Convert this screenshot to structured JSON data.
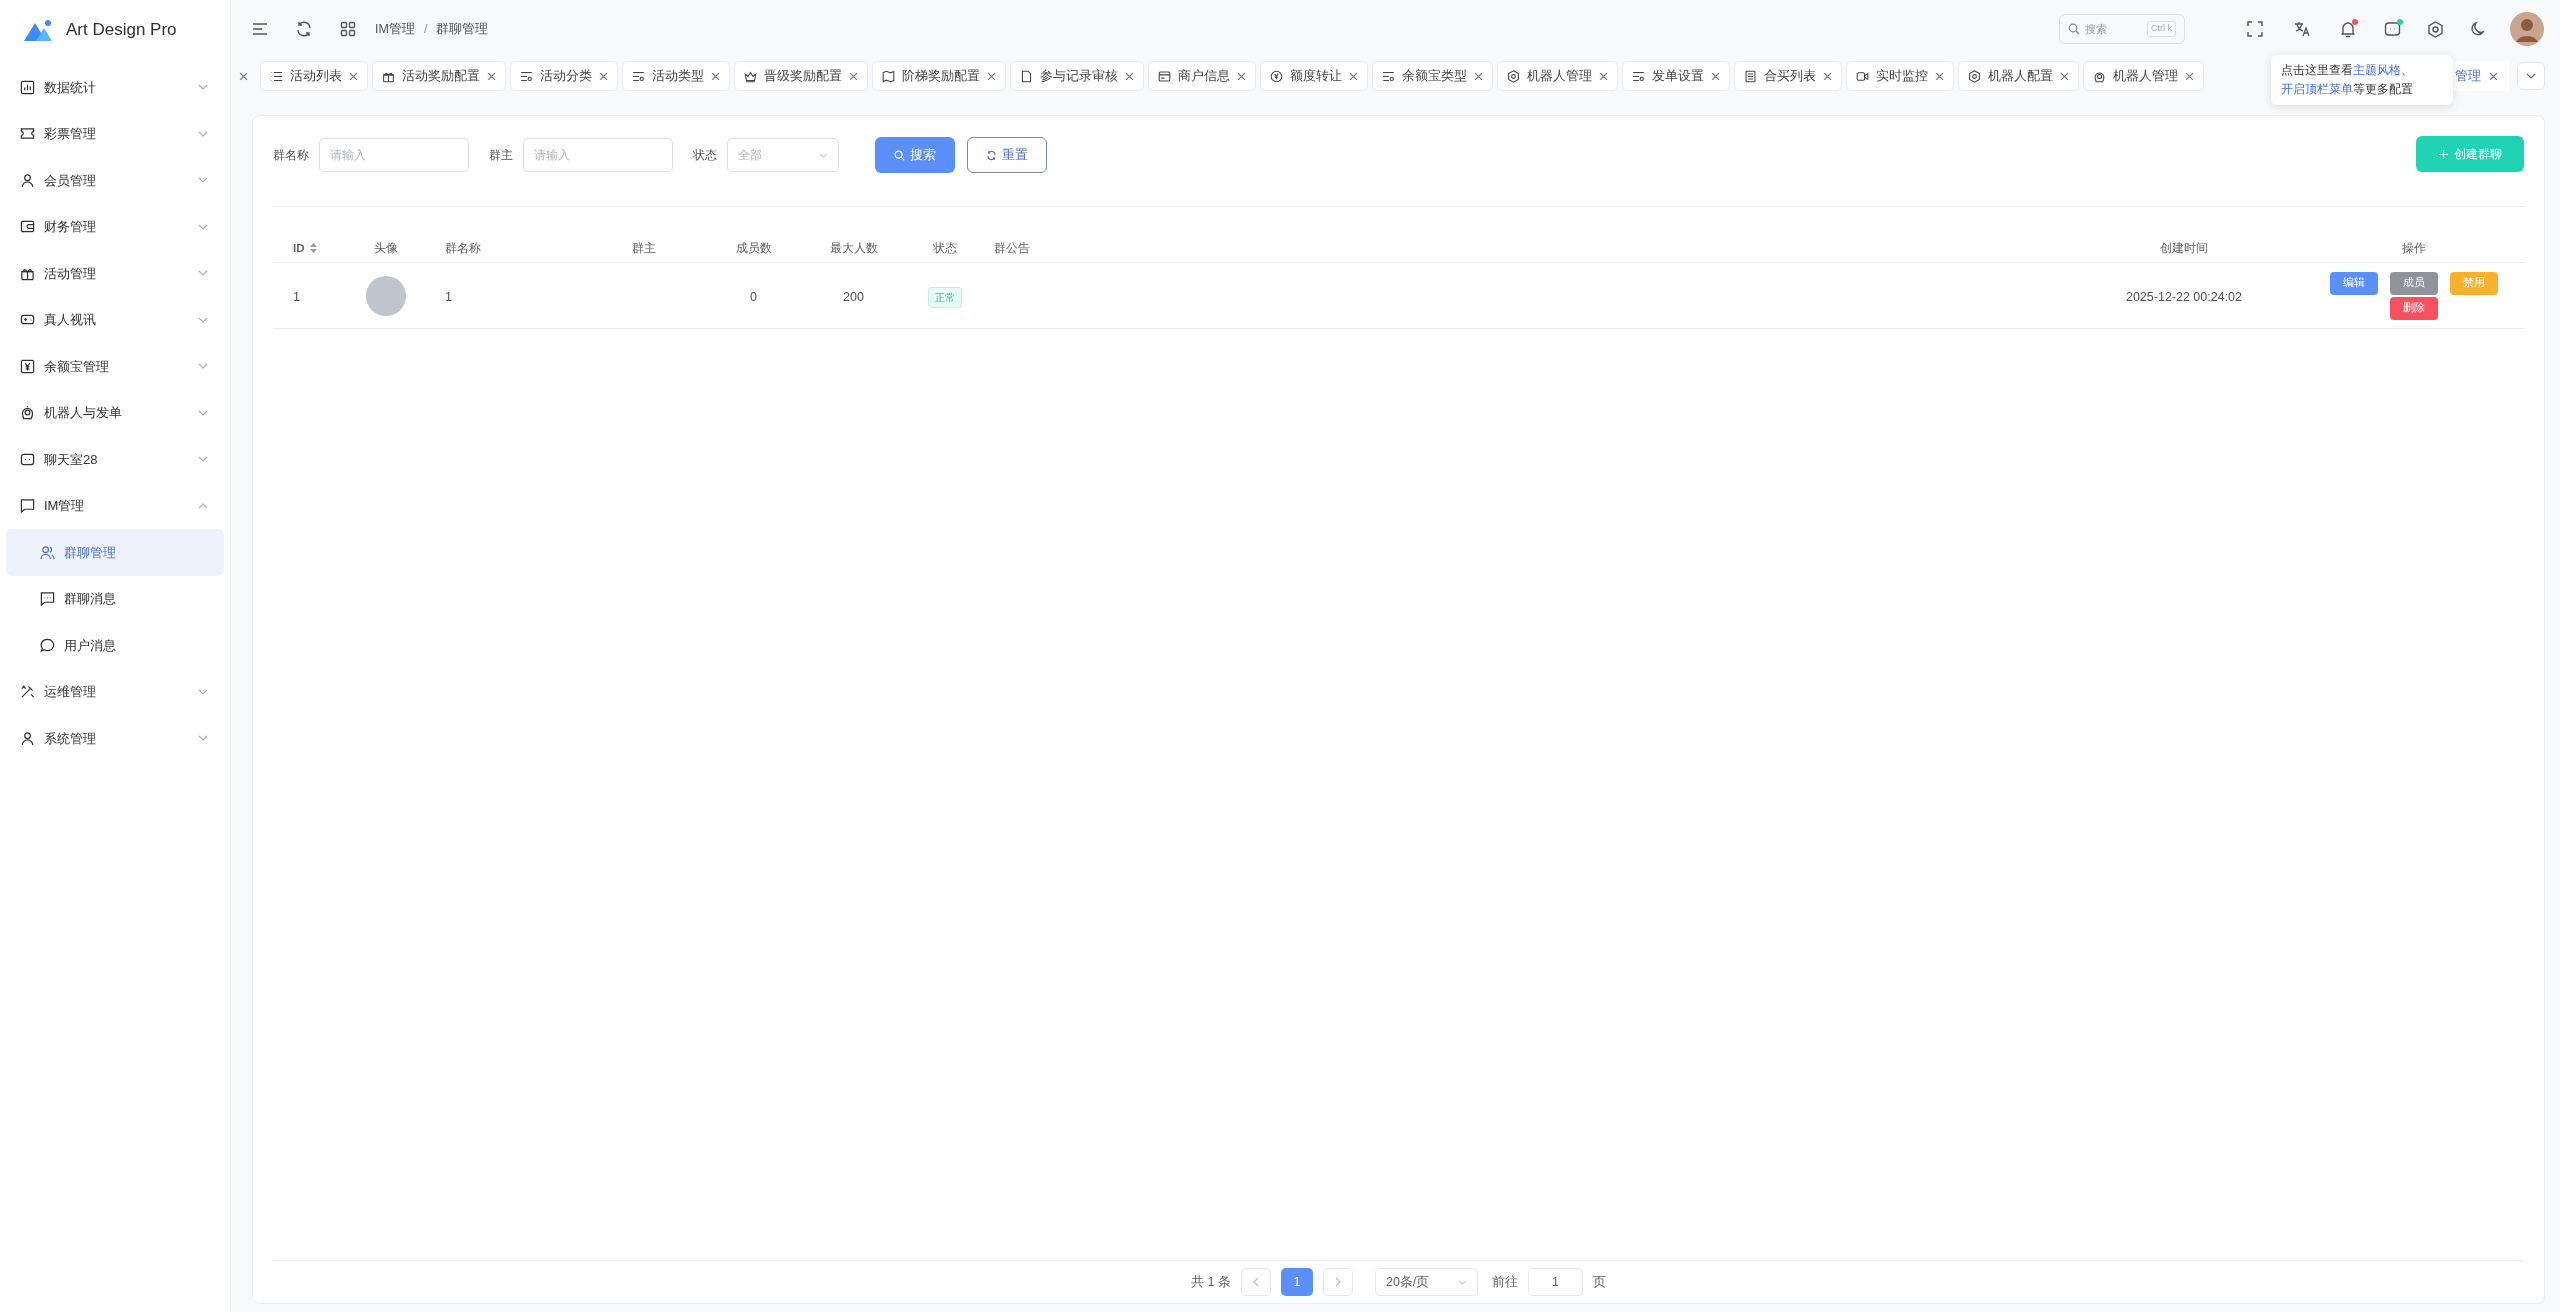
{
  "app": {
    "name": "Art Design Pro"
  },
  "sidebar": {
    "items": [
      {
        "label": "数据统计",
        "expanded": false,
        "selected": false
      },
      {
        "label": "彩票管理",
        "expanded": false,
        "selected": false
      },
      {
        "label": "会员管理",
        "expanded": false,
        "selected": false
      },
      {
        "label": "财务管理",
        "expanded": false,
        "selected": false
      },
      {
        "label": "活动管理",
        "expanded": false,
        "selected": false
      },
      {
        "label": "真人视讯",
        "expanded": false,
        "selected": false
      },
      {
        "label": "余额宝管理",
        "expanded": false,
        "selected": false
      },
      {
        "label": "机器人与发单",
        "expanded": false,
        "selected": false
      },
      {
        "label": "聊天室28",
        "expanded": false,
        "selected": false
      },
      {
        "label": "IM管理",
        "expanded": true,
        "selected": false,
        "children": [
          {
            "label": "群聊管理",
            "selected": true
          },
          {
            "label": "群聊消息",
            "selected": false
          },
          {
            "label": "用户消息",
            "selected": false
          }
        ]
      },
      {
        "label": "运维管理",
        "expanded": false,
        "selected": false
      },
      {
        "label": "系统管理",
        "expanded": false,
        "selected": false
      }
    ]
  },
  "header": {
    "breadcrumb": [
      "IM管理",
      "群聊管理"
    ],
    "separator": "/",
    "search": {
      "placeholder": "搜索",
      "shortcut": "Ctrl k"
    },
    "notifications_unread": true,
    "messages_unread": true
  },
  "tabs": [
    {
      "kind": "cut",
      "selected": false
    },
    {
      "kind": "tab",
      "label": "活动列表",
      "selected": false
    },
    {
      "kind": "tab",
      "label": "活动奖励配置",
      "selected": false
    },
    {
      "kind": "tab",
      "label": "活动分类",
      "selected": false
    },
    {
      "kind": "tab",
      "label": "活动类型",
      "selected": false
    },
    {
      "kind": "tab",
      "label": "晋级奖励配置",
      "selected": false
    },
    {
      "kind": "tab",
      "label": "阶梯奖励配置",
      "selected": false
    },
    {
      "kind": "tab",
      "label": "参与记录审核",
      "selected": false
    },
    {
      "kind": "tab",
      "label": "商户信息",
      "selected": false
    },
    {
      "kind": "tab",
      "label": "额度转让",
      "selected": false
    },
    {
      "kind": "tab",
      "label": "余额宝类型",
      "selected": false
    },
    {
      "kind": "tab",
      "label": "机器人管理",
      "selected": false
    },
    {
      "kind": "tab",
      "label": "发单设置",
      "selected": false
    },
    {
      "kind": "tab",
      "label": "合买列表",
      "selected": false
    },
    {
      "kind": "tab",
      "label": "实时监控",
      "selected": false
    },
    {
      "kind": "tab",
      "label": "机器人配置",
      "selected": false
    },
    {
      "kind": "tab",
      "label": "机器人管理",
      "selected": false
    },
    {
      "kind": "covered",
      "label": "管理",
      "selected": true
    }
  ],
  "tooltip": {
    "lines": [
      [
        {
          "text": "点击这里查看"
        },
        {
          "text": "主题风格",
          "link": true
        },
        {
          "text": "、"
        }
      ],
      [
        {
          "text": "开启顶栏菜单",
          "link": true
        },
        {
          "text": "等更多配置"
        }
      ]
    ]
  },
  "filters": [
    {
      "kind": "input",
      "label": "群名称",
      "placeholder": "请输入"
    },
    {
      "kind": "input",
      "label": "群主",
      "placeholder": "请输入"
    },
    {
      "kind": "select",
      "label": "状态",
      "placeholder": "全部"
    }
  ],
  "filter_buttons": {
    "search": "搜索",
    "reset": "重置"
  },
  "create_button": "创建群聊",
  "table": {
    "columns": [
      {
        "label": "ID",
        "kind": "text",
        "sortable": true
      },
      {
        "label": "头像",
        "kind": "avatar",
        "sortable": false
      },
      {
        "label": "群名称",
        "kind": "text",
        "sortable": false
      },
      {
        "label": "群主",
        "kind": "text",
        "sortable": false
      },
      {
        "label": "成员数",
        "kind": "text",
        "sortable": false
      },
      {
        "label": "最大人数",
        "kind": "text",
        "sortable": false
      },
      {
        "label": "状态",
        "kind": "status",
        "sortable": false
      },
      {
        "label": "群公告",
        "kind": "text",
        "sortable": false
      },
      {
        "label": "创建时间",
        "kind": "text",
        "sortable": false
      },
      {
        "label": "操作",
        "kind": "actions",
        "sortable": false
      }
    ],
    "rows": [
      {
        "cells": [
          {
            "text": "1"
          },
          {},
          {
            "text": "1"
          },
          {},
          {
            "text": "0"
          },
          {
            "text": "200"
          },
          {
            "text": "正常"
          },
          {},
          {
            "text": "2025-12-22 00:24:02"
          },
          {
            "actions": [
              {
                "label": "编辑",
                "color": "#5b8ff9"
              },
              {
                "label": "成员",
                "color": "#909399"
              },
              {
                "label": "禁用",
                "color": "#f7b12d"
              },
              {
                "label": "删除",
                "color": "#f5515f"
              }
            ]
          }
        ]
      }
    ]
  },
  "pagination": {
    "total": "共 1 条",
    "pages": [
      {
        "label": "1",
        "selected": true
      }
    ],
    "page_size": "20条/页",
    "goto_label": "前往",
    "goto_value": "1",
    "goto_suffix": "页"
  }
}
